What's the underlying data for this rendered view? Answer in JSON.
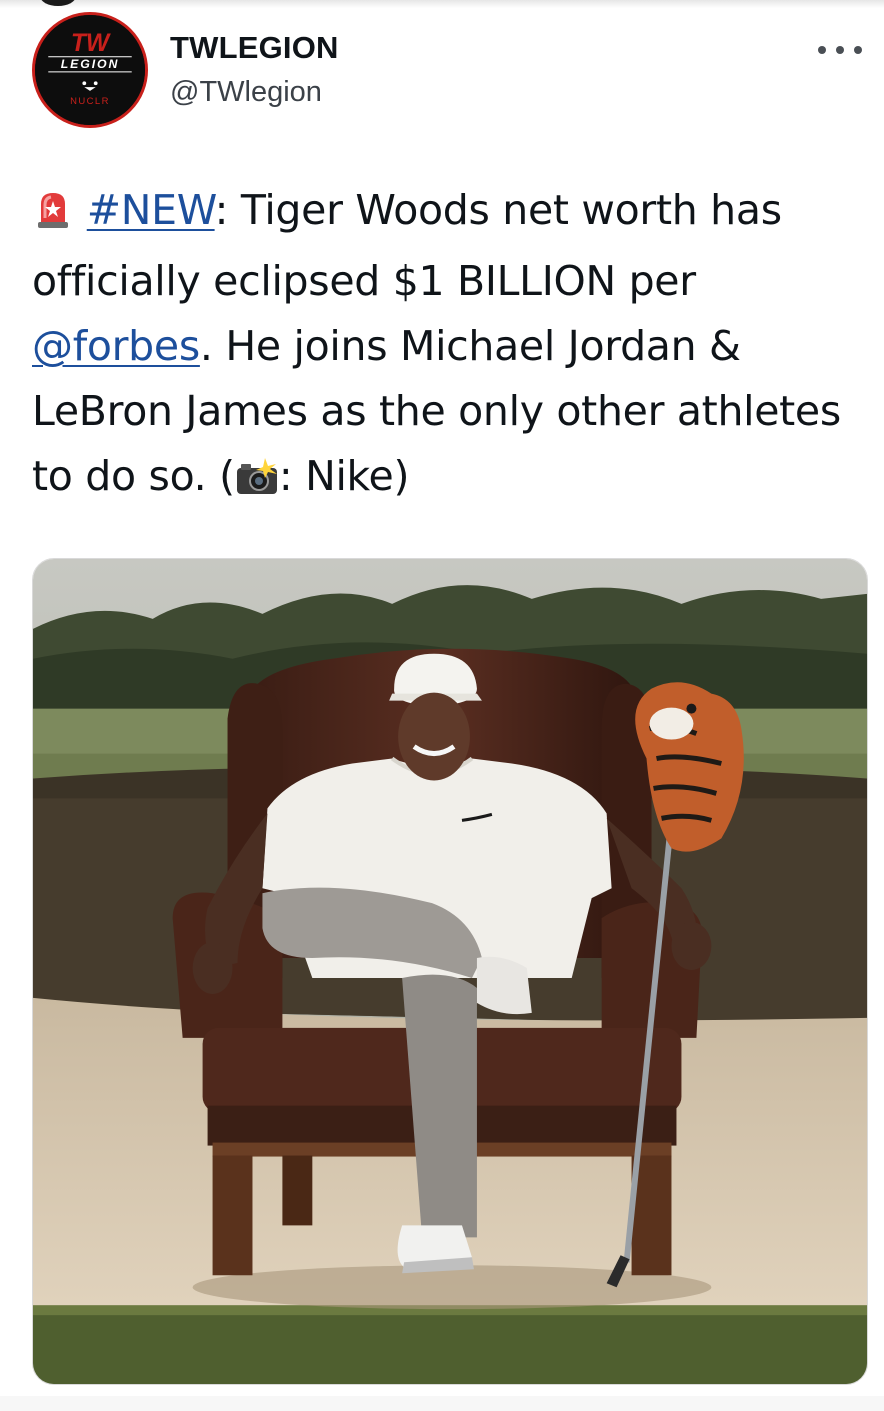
{
  "tweet": {
    "author": {
      "display_name": "TWLEGION",
      "handle": "@TWlegion",
      "avatar_text_top": "TW",
      "avatar_text_mid": "LEGION",
      "avatar_text_bottom": "NUCLR"
    },
    "more_icon": "more-horizontal-icon",
    "text": {
      "alert_icon": "rotating-light-emoji",
      "hashtag": "#NEW",
      "part1": ": Tiger Woods net worth has officially eclipsed $1 BILLION per ",
      "mention": "@forbes",
      "part2": ". He joins Michael Jordan & LeBron James as the only other athletes to do so. (",
      "camera_icon": "camera-flash-emoji",
      "part3": ": Nike)"
    },
    "media": {
      "type": "photo"
    }
  },
  "colors": {
    "link": "#1d4f9c",
    "avatar_ring": "#c8201b",
    "text": "#0f1419",
    "secondary": "#3b4148"
  }
}
